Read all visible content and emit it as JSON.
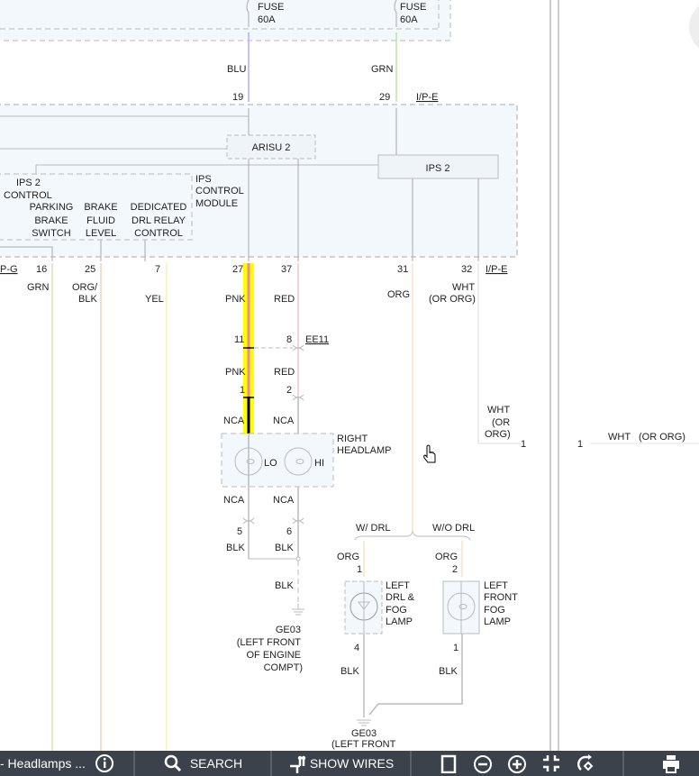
{
  "diagram": {
    "fuse_left": {
      "label": "FUSE",
      "rating": "60A",
      "wire_color": "BLU",
      "pin": "19"
    },
    "fuse_right": {
      "label": "FUSE",
      "rating": "60A",
      "wire_color": "GRN",
      "pin": "29"
    },
    "connector_ipe_top": "I/P-E",
    "module": {
      "arisu": "ARISU 2",
      "ips2": "IPS 2",
      "ips_control_module": [
        "IPS",
        "CONTROL",
        "MODULE"
      ],
      "ips2_control": [
        "IPS 2",
        "CONTROL"
      ],
      "parking_brake": [
        "PARKING",
        "BRAKE",
        "SWITCH"
      ],
      "brake_fluid": [
        "BRAKE",
        "FLUID",
        "LEVEL"
      ],
      "drl_relay": [
        "DEDICATED",
        "DRL RELAY",
        "CONTROL"
      ]
    },
    "bottom_pins": {
      "connector_left": "P-G",
      "connector_right": "I/P-E",
      "pins": [
        "16",
        "25",
        "7",
        "27",
        "37",
        "31",
        "32"
      ]
    },
    "wire_colors": {
      "grn": "GRN",
      "orgblk_1": "ORG/",
      "orgblk_2": "BLK",
      "yel": "YEL",
      "pnk": "PNK",
      "red": "RED",
      "org": "ORG",
      "wht_1": "WHT",
      "wht_2": "(OR ORG)"
    },
    "ee11": {
      "name": "EE11",
      "pin_a": "11",
      "pin_b": "8",
      "wire_a": "PNK",
      "wire_b": "RED",
      "pin_c": "1",
      "pin_d": "2"
    },
    "headlamp": {
      "nca_top_a": "NCA",
      "nca_top_b": "NCA",
      "lo": "LO",
      "hi": "HI",
      "name": [
        "RIGHT",
        "HEADLAMP"
      ],
      "nca_bot_a": "NCA",
      "nca_bot_b": "NCA",
      "pin_a": "5",
      "pin_b": "6",
      "wire_a": "BLK",
      "wire_b": "BLK",
      "ground_wire": "BLK"
    },
    "ground_1": [
      "GE03",
      "(LEFT FRONT",
      "OF ENGINE",
      "COMPT)"
    ],
    "drl_branch": {
      "with": "W/ DRL",
      "without": "W/O DRL"
    },
    "drl_lamp": {
      "wire": "ORG",
      "pin_in": "1",
      "name": [
        "LEFT",
        "DRL &",
        "FOG",
        "LAMP"
      ],
      "pin_out": "4",
      "ground_wire": "BLK"
    },
    "fog_lamp": {
      "wire": "ORG",
      "pin_in": "2",
      "name": [
        "LEFT",
        "FRONT",
        "FOG",
        "LAMP"
      ],
      "pin_out": "1",
      "ground_wire": "BLK"
    },
    "ground_2": [
      "GE03",
      "(LEFT FRONT"
    ],
    "wht_offpage": {
      "left": [
        "WHT",
        "(OR",
        "ORG)"
      ],
      "pin_left": "1",
      "pin_right": "1",
      "right": "WHT   (OR ORG)"
    },
    "highlight_color": "#ffff00"
  },
  "toolbar": {
    "title": "- Headlamps ...",
    "search": "SEARCH",
    "show_wires": "SHOW WIRES"
  }
}
